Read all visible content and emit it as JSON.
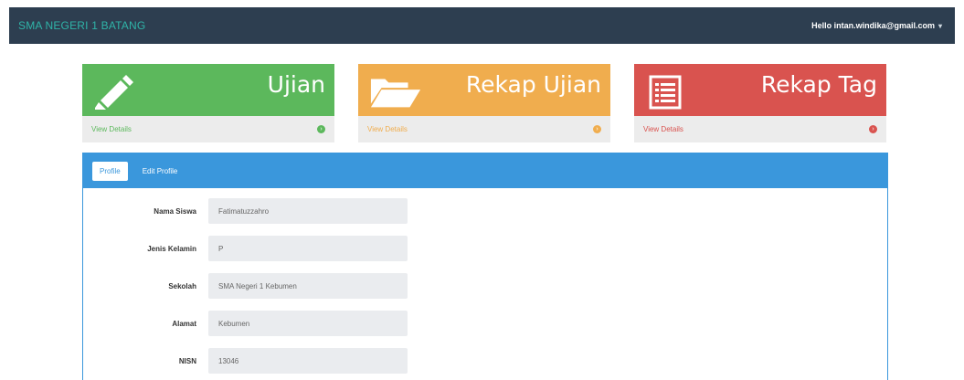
{
  "navbar": {
    "brand": "SMA NEGERI 1 BATANG",
    "user": "Hello intan.windika@gmail.com",
    "caret": "▾"
  },
  "panels": [
    {
      "title": "Ujian",
      "footer": "View Details",
      "icon": "pencil-icon",
      "color": "#5cb85c"
    },
    {
      "title": "Rekap Ujian",
      "footer": "View Details",
      "icon": "folder-open-icon",
      "color": "#f0ad4e"
    },
    {
      "title": "Rekap Tag",
      "footer": "View Details",
      "icon": "list-alt-icon",
      "color": "#d9534f"
    }
  ],
  "tabs": {
    "profile": "Profile",
    "edit": "Edit Profile"
  },
  "form": {
    "fields": [
      {
        "label": "Nama Siswa",
        "value": "Fatimatuzzahro"
      },
      {
        "label": "Jenis Kelamin",
        "value": "P"
      },
      {
        "label": "Sekolah",
        "value": "SMA Negeri 1 Kebumen"
      },
      {
        "label": "Alamat",
        "value": "Kebumen"
      },
      {
        "label": "NISN",
        "value": "13046"
      }
    ]
  },
  "colors": {
    "navbar": "#2d3e50",
    "brand": "#2fb4a8",
    "tabbar": "#3a97dc"
  }
}
